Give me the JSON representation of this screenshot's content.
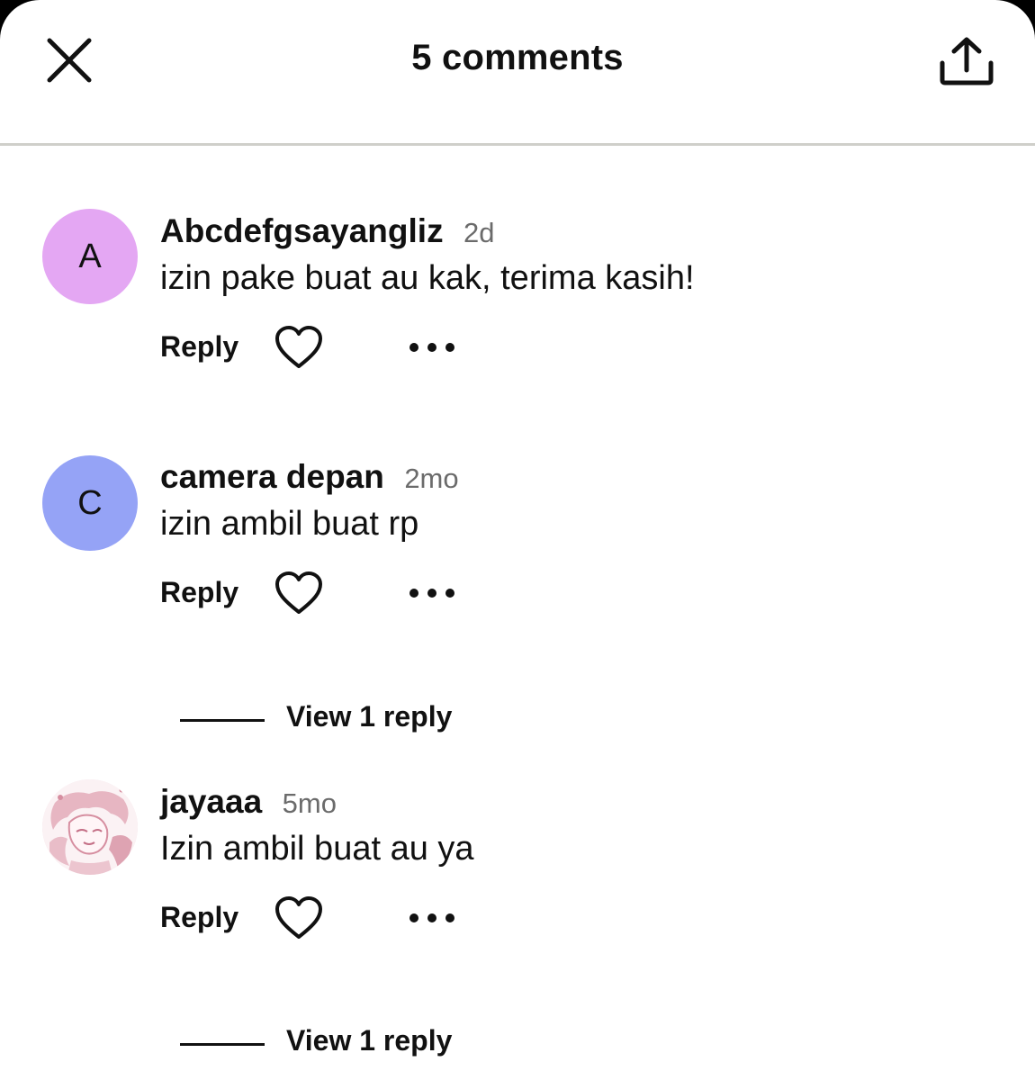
{
  "header": {
    "title": "5 comments",
    "close_icon": "close-icon",
    "share_icon": "share-icon"
  },
  "comments": [
    {
      "avatar_letter": "A",
      "avatar_color": "#e4a7f3",
      "author": "Abcdefgsayangliz",
      "age": "2d",
      "text": "izin pake buat au kak, terima kasih!",
      "reply_label": "Reply"
    },
    {
      "avatar_letter": "C",
      "avatar_color": "#95a3f6",
      "author": "camera depan",
      "age": "2mo",
      "text": "izin ambil buat rp",
      "reply_label": "Reply",
      "view_replies_label": "View 1 reply"
    },
    {
      "avatar_letter": "",
      "avatar_color": "#f3dde3",
      "author": "jayaaa",
      "age": "5mo",
      "text": "Izin ambil buat au ya",
      "reply_label": "Reply",
      "view_replies_label": "View 1 reply"
    }
  ],
  "colors": {
    "divider": "#cfcfca",
    "text": "#111111",
    "muted": "#6b6b6b"
  }
}
